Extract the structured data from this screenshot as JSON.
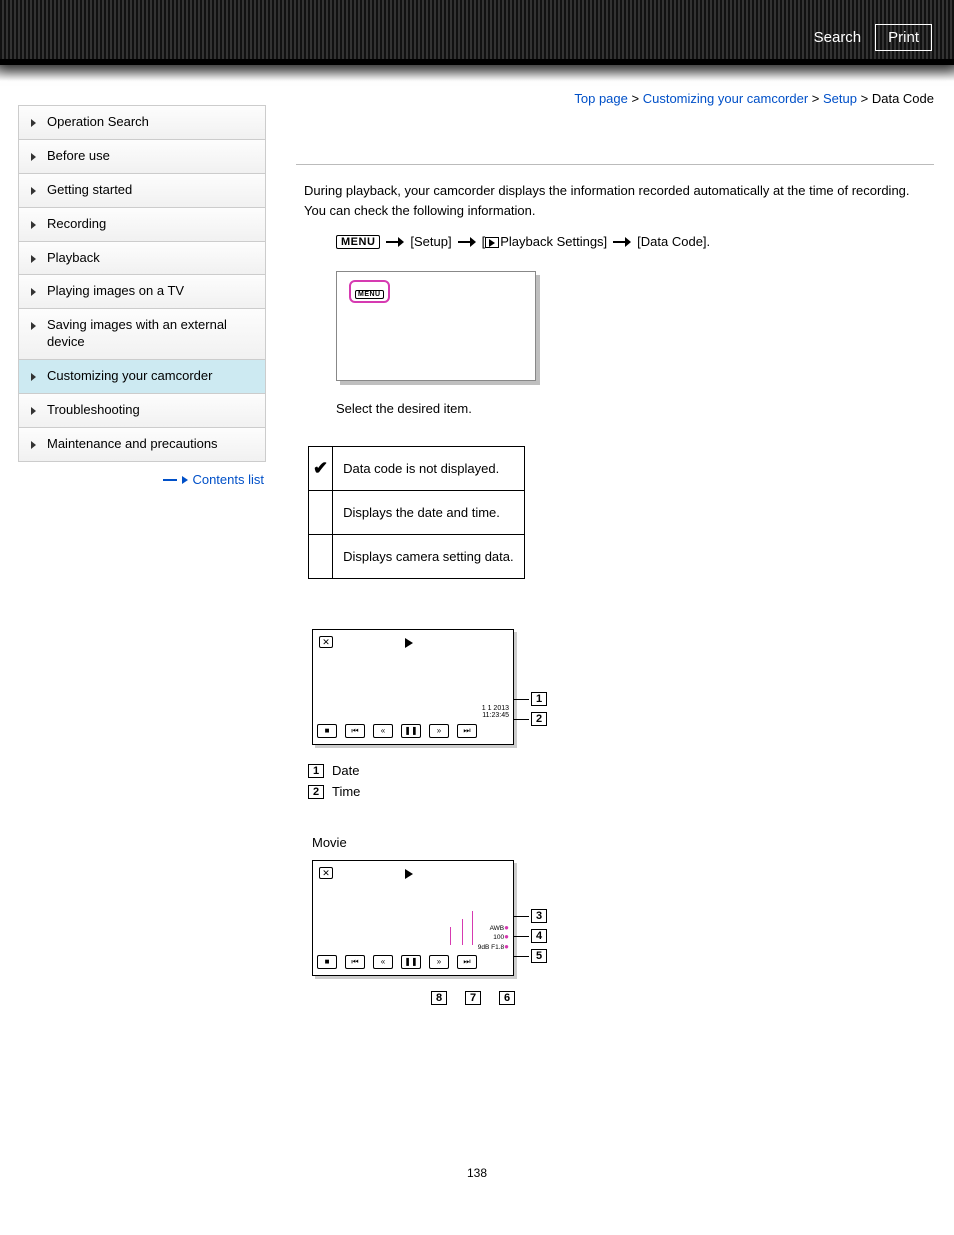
{
  "header": {
    "search": "Search",
    "print": "Print"
  },
  "breadcrumb": {
    "a": "Top page",
    "b": "Customizing your camcorder",
    "c": "Setup",
    "d": "Data Code"
  },
  "sidebar": {
    "items": [
      "Operation Search",
      "Before use",
      "Getting started",
      "Recording",
      "Playback",
      "Playing images on a TV",
      "Saving images with an external device",
      "Customizing your camcorder",
      "Troubleshooting",
      "Maintenance and precautions"
    ],
    "contents_link": "Contents list"
  },
  "intro": "During playback, your camcorder displays the information recorded automatically at the time of recording. You can check the following information.",
  "procedure": {
    "menu_chip": "MENU",
    "step1": "[Setup]",
    "step2_prefix": "[",
    "step2_label": "Playback Settings]",
    "step3": "[Data Code]."
  },
  "caption": "Select the desired item.",
  "options": [
    {
      "icon": "check",
      "text": "Data code is not displayed."
    },
    {
      "icon": "",
      "text": "Displays the date and time."
    },
    {
      "icon": "",
      "text": "Displays camera setting data."
    }
  ],
  "datetime_panel": {
    "date_line": "1  1 2013",
    "time_line": "11:23:45",
    "legend": [
      {
        "num": "1",
        "label": "Date"
      },
      {
        "num": "2",
        "label": "Time"
      }
    ]
  },
  "camera_section_label": "Movie",
  "camera_panel": {
    "lines": [
      "AWB",
      "100",
      "9dB   F1.8"
    ],
    "right_callouts": [
      "3",
      "4",
      "5"
    ],
    "bottom_callouts": [
      "8",
      "7",
      "6"
    ]
  },
  "page_number": "138"
}
